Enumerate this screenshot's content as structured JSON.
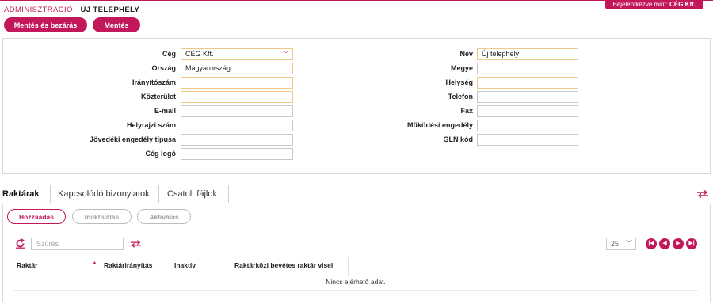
{
  "header": {
    "login_prefix": "Bejelentkezve mint:",
    "login_user": "CÉG Kft.",
    "breadcrumb_root": "ADMINISZTRÁCIÓ",
    "breadcrumb_separator": "·",
    "breadcrumb_current": "ÚJ TELEPHELY"
  },
  "toolbar": {
    "save_close_label": "Mentés és bezárás",
    "save_label": "Mentés"
  },
  "form": {
    "left": [
      {
        "label": "Cég",
        "value": "CÉG Kft.",
        "required": true,
        "control": "select"
      },
      {
        "label": "Ország",
        "value": "Magyarország",
        "required": true,
        "control": "lookup"
      },
      {
        "label": "Irányítószám",
        "value": "",
        "required": true,
        "control": "text"
      },
      {
        "label": "Közterület",
        "value": "",
        "required": true,
        "control": "text"
      },
      {
        "label": "E-mail",
        "value": "",
        "required": false,
        "control": "text"
      },
      {
        "label": "Helyrajzi szám",
        "value": "",
        "required": false,
        "control": "text"
      },
      {
        "label": "Jövedéki engedély típusa",
        "value": "",
        "required": false,
        "control": "text"
      },
      {
        "label": "Cég logó",
        "value": "",
        "required": false,
        "control": "text"
      }
    ],
    "right": [
      {
        "label": "Név",
        "value": "Új telephely",
        "required": true,
        "control": "text"
      },
      {
        "label": "Megye",
        "value": "",
        "required": false,
        "control": "text"
      },
      {
        "label": "Helység",
        "value": "",
        "required": true,
        "control": "text"
      },
      {
        "label": "Telefon",
        "value": "",
        "required": false,
        "control": "text"
      },
      {
        "label": "Fax",
        "value": "",
        "required": false,
        "control": "text"
      },
      {
        "label": "Működési engedély",
        "value": "",
        "required": false,
        "control": "text"
      },
      {
        "label": "GLN kód",
        "value": "",
        "required": false,
        "control": "text"
      }
    ],
    "lookup_glyph": "...",
    "select_glyph": "﹀"
  },
  "tabs": [
    {
      "label": "Raktárak",
      "active": true
    },
    {
      "label": "Kapcsolódó bizonylatok",
      "active": false
    },
    {
      "label": "Csatolt fájlok",
      "active": false
    }
  ],
  "grid": {
    "add_label": "Hozzáadás",
    "deactivate_label": "Inaktiválás",
    "activate_label": "Aktiválás",
    "filter_placeholder": "Szűrés",
    "page_size": "25",
    "columns": [
      "Raktár",
      "Raktárirányítás",
      "Inaktív",
      "Raktárközi bevétes raktár visel"
    ],
    "empty_message": "Nincs elérhető adat."
  },
  "icons": {
    "refresh": "refresh-icon",
    "swap": "swap-arrows-icon",
    "first_page": "first-page-icon",
    "prev_page": "prev-page-icon",
    "next_page": "next-page-icon",
    "last_page": "last-page-icon",
    "sort": "sort-asc-icon"
  },
  "colors": {
    "accent": "#c2185b",
    "required_border": "#f0c98a",
    "field_border": "#c8c8c8",
    "disabled_text": "#9e9e9e"
  }
}
